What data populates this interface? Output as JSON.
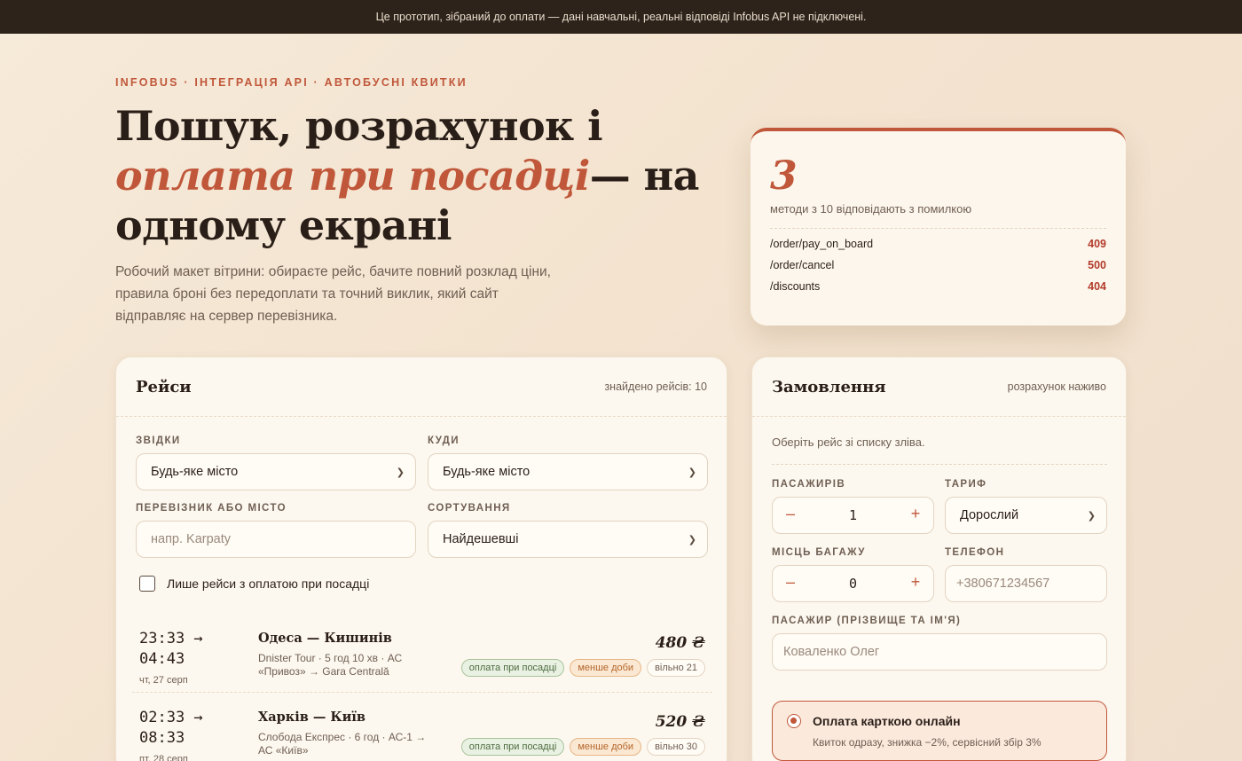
{
  "banner": "Це прототип, зібраний до оплати — дані навчальні, реальні відповіді Infobus API не підключені.",
  "hero": {
    "eyebrow": "INFOBUS · ІНТЕГРАЦІЯ API · АВТОБУСНІ КВИТКИ",
    "title_part1": "Пошук, розрахунок і ",
    "title_accent": "оплата при посадці",
    "title_part2": "— на одному екрані",
    "subtitle": "Робочий макет вітрини: обираєте рейс, бачите повний розклад ціни, правила броні без передоплати та точний виклик, який сайт відправляє на сервер перевізника."
  },
  "stats": {
    "number": "3",
    "caption": "методи з 10 відповідають з помилкою",
    "errors": [
      {
        "endpoint": "/order/pay_on_board",
        "code": "409"
      },
      {
        "endpoint": "/order/cancel",
        "code": "500"
      },
      {
        "endpoint": "/discounts",
        "code": "404"
      }
    ]
  },
  "trips_panel": {
    "title": "Рейси",
    "found": "знайдено рейсів: 10",
    "from_label": "ЗВІДКИ",
    "from_value": "Будь-яке місто",
    "to_label": "КУДИ",
    "to_value": "Будь-яке місто",
    "carrier_label": "ПЕРЕВІЗНИК АБО МІСТО",
    "carrier_placeholder": "напр. Karpaty",
    "sort_label": "СОРТУВАННЯ",
    "sort_value": "Найдешевші",
    "checkbox_label": "Лише рейси з оплатою при посадці",
    "trips": [
      {
        "time_dep": "23:33 →",
        "time_arr": "04:43",
        "date": "чт, 27 серп",
        "route": "Одеса — Кишинів",
        "desc": "Dnister Tour · 5 год 10 хв · АС «Привоз» → Gara Centrală",
        "price": "480 ₴",
        "tag_pay": "оплата при посадці",
        "tag_short": "менше доби",
        "tag_free": "вільно 21"
      },
      {
        "time_dep": "02:33 →",
        "time_arr": "08:33",
        "date": "пт, 28 серп",
        "route": "Харків — Київ",
        "desc": "Слобода Експрес · 6 год · АС-1 → АС «Київ»",
        "price": "520 ₴",
        "tag_pay": "оплата при посадці",
        "tag_short": "менше доби",
        "tag_free": "вільно 30"
      }
    ]
  },
  "order_panel": {
    "title": "Замовлення",
    "meta": "розрахунок наживо",
    "hint": "Оберіть рейс зі списку зліва.",
    "passengers_label": "ПАСАЖИРІВ",
    "passengers_value": "1",
    "tariff_label": "ТАРИФ",
    "tariff_value": "Дорослий",
    "baggage_label": "МІСЦЬ БАГАЖУ",
    "baggage_value": "0",
    "phone_label": "ТЕЛЕФОН",
    "phone_placeholder": "+380671234567",
    "name_label": "ПАСАЖИР (ПРІЗВИЩЕ ТА ІМ'Я)",
    "name_placeholder": "Коваленко Олег",
    "minus": "–",
    "plus": "+",
    "payment": {
      "title": "Оплата карткою онлайн",
      "desc": "Квиток одразу, знижка −2%, сервісний збір 3%"
    }
  },
  "colors": {
    "accent": "#c0573a",
    "banner_bg": "#2e231b",
    "error_code": "#b23a2a"
  }
}
